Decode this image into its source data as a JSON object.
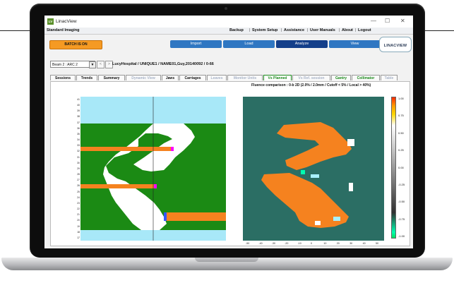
{
  "app": {
    "title": "LinacView",
    "icon_text": "LV",
    "window_controls": [
      "—",
      "☐",
      "✕"
    ]
  },
  "menubar": {
    "brand": "Standard Imaging",
    "items": [
      "Backup",
      "System Setup",
      "Assistance",
      "User Manuals",
      "About",
      "Logout"
    ],
    "separator": "|"
  },
  "toolbar": {
    "batch_label": "BATCH IS ON",
    "nav": [
      "Import",
      "Load",
      "Analyze",
      "View"
    ],
    "logo": "LINACVIEW"
  },
  "beam": {
    "selected": "Beam 2 : ARC 2",
    "arrow": "▼",
    "prev": "<",
    "next": ">"
  },
  "patient_path": "LucyHospital / UNIQUE1 / NAME01,Guy,20140092 / 0-66",
  "tabs": [
    {
      "label": "Sessions",
      "state": "normal"
    },
    {
      "label": "Trends",
      "state": "normal"
    },
    {
      "label": "Summary",
      "state": "normal"
    },
    {
      "label": "Dynamic View",
      "state": "disabled"
    },
    {
      "label": "Jaws",
      "state": "normal"
    },
    {
      "label": "Carriages",
      "state": "normal"
    },
    {
      "label": "Leaves",
      "state": "disabled"
    },
    {
      "label": "Monitor Units",
      "state": "disabled"
    },
    {
      "label": "Vs Planned",
      "state": "active"
    },
    {
      "label": "Vs Ref. session",
      "state": "disabled"
    },
    {
      "label": "Gantry",
      "state": "green"
    },
    {
      "label": "Collimator",
      "state": "green"
    },
    {
      "label": "Table",
      "state": "disabled"
    }
  ],
  "fluence_title": "Fluence comparison : 0-b 2D (2.0% / 2.0mm / Cutoff < 5% / Local > 40%)",
  "left_plot": {
    "y_labels": [
      "41",
      "40",
      "39",
      "38",
      "37",
      "36",
      "35",
      "34",
      "33",
      "32",
      "31",
      "30",
      "29",
      "28",
      "27",
      "26",
      "25",
      "24",
      "23",
      "22",
      "21",
      "20",
      "19",
      "18",
      "17"
    ]
  },
  "right_plot": {
    "x_labels": [
      "-50",
      "-40",
      "-30",
      "-20",
      "-10",
      "0",
      "10",
      "20",
      "30",
      "40",
      "50"
    ]
  },
  "colorbar": {
    "labels": [
      "1.00",
      "0.75",
      "0.50",
      "0.25",
      "0.00",
      "-0.25",
      "-0.50",
      "-0.75",
      "-1.00"
    ]
  },
  "colors": {
    "batch": "#f59a23",
    "nav_blue": "#2f77c2",
    "nav_active": "#143f8a",
    "green_field": "#1b8a14",
    "teal_bg": "#2b6e64",
    "orange": "#f5821f",
    "cyan": "#a8e8f8"
  }
}
